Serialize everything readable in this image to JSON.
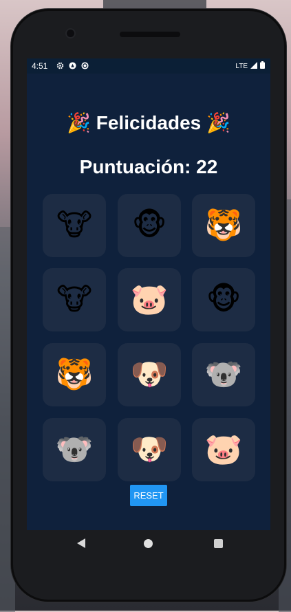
{
  "status_bar": {
    "time": "4:51",
    "left_icons": [
      "gear-icon",
      "android-icon",
      "sync-icon"
    ],
    "network": "LTE",
    "signal_icon": "signal-icon",
    "battery_icon": "battery-icon"
  },
  "game": {
    "title": "🎉 Felicidades 🎉",
    "score_text": "Puntuación: 22",
    "tiles": [
      "🐮",
      "🐵",
      "🐯",
      "🐮",
      "🐷",
      "🐵",
      "🐯",
      "🐶",
      "🐨",
      "🐨",
      "🐶",
      "🐷"
    ],
    "reset_label": "RESET"
  },
  "nav_bar": {
    "buttons": [
      "back-button",
      "home-button",
      "recents-button"
    ]
  },
  "colors": {
    "app_background": "#0f213c",
    "tile_background": "#1d2c44",
    "reset_button": "#2196f3"
  }
}
